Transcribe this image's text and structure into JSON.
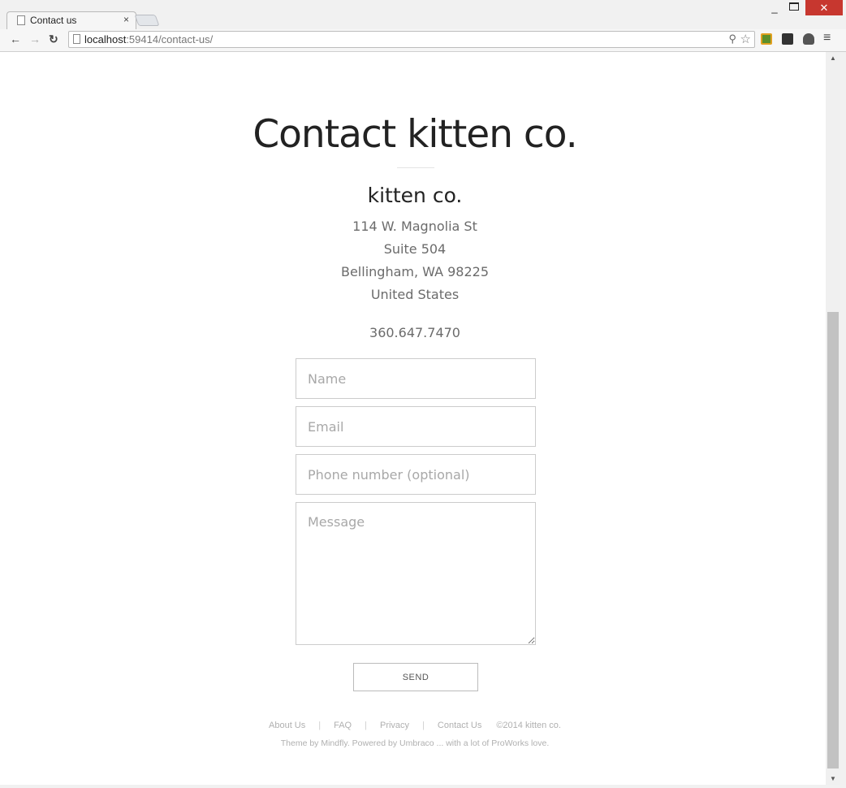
{
  "browser": {
    "tab_title": "Contact us",
    "tab_close": "×",
    "url_host": "localhost",
    "url_path": ":59414/contact-us/",
    "minimize": "_",
    "close": "✕"
  },
  "page": {
    "title": "Contact kitten co.",
    "company": "kitten co.",
    "address": [
      "114 W. Magnolia St",
      "Suite 504",
      "Bellingham, WA 98225",
      "United States"
    ],
    "phone": "360.647.7470"
  },
  "form": {
    "name_placeholder": "Name",
    "email_placeholder": "Email",
    "phone_placeholder": "Phone number (optional)",
    "message_placeholder": "Message",
    "send_label": "SEND"
  },
  "footer": {
    "links": [
      "About Us",
      "FAQ",
      "Privacy",
      "Contact Us"
    ],
    "separator": "|",
    "copyright": "©2014 kitten co.",
    "credit": "Theme by Mindfly. Powered by Umbraco ... with a lot of ProWorks love."
  }
}
